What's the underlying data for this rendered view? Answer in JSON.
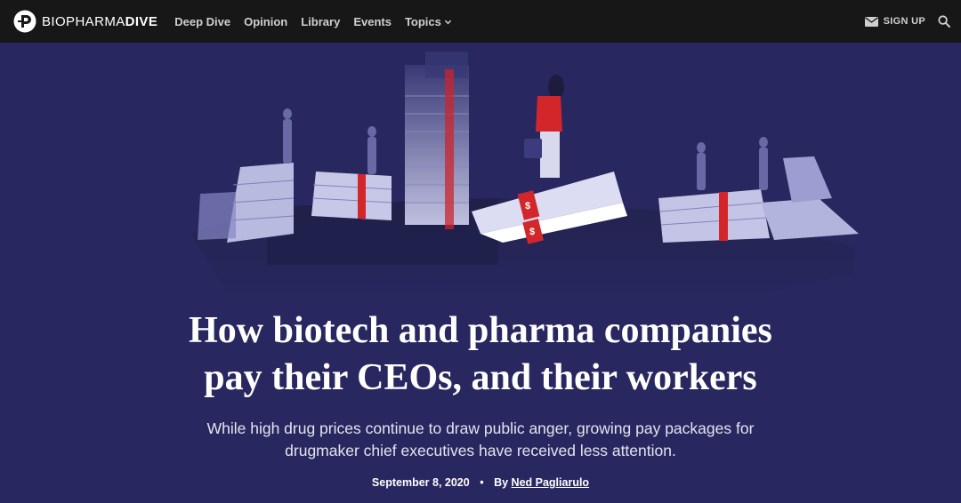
{
  "brand": {
    "part1": "BIOPHARMA",
    "part2": "DIVE"
  },
  "nav": {
    "items": [
      {
        "label": "Deep Dive"
      },
      {
        "label": "Opinion"
      },
      {
        "label": "Library"
      },
      {
        "label": "Events"
      },
      {
        "label": "Topics"
      }
    ],
    "signup_label": "SIGN UP"
  },
  "icons": {
    "logo": "logo-mark-icon",
    "topics_chevron": "chevron-down-icon",
    "signup": "mail-icon",
    "search": "search-icon"
  },
  "colors": {
    "topbar_bg": "#171717",
    "hero_bg": "#28275f",
    "accent_red": "#d3262b"
  },
  "article": {
    "headline_line1": "How biotech and pharma companies",
    "headline_line2": "pay their CEOs, and their workers",
    "dek_line1": "While high drug prices continue to draw public anger, growing pay packages for",
    "dek_line2": "drugmaker chief executives have received less attention.",
    "date": "September 8, 2020",
    "separator": "•",
    "by_prefix": "By",
    "author": "Ned Pagliarulo",
    "image_description_visible": ""
  }
}
